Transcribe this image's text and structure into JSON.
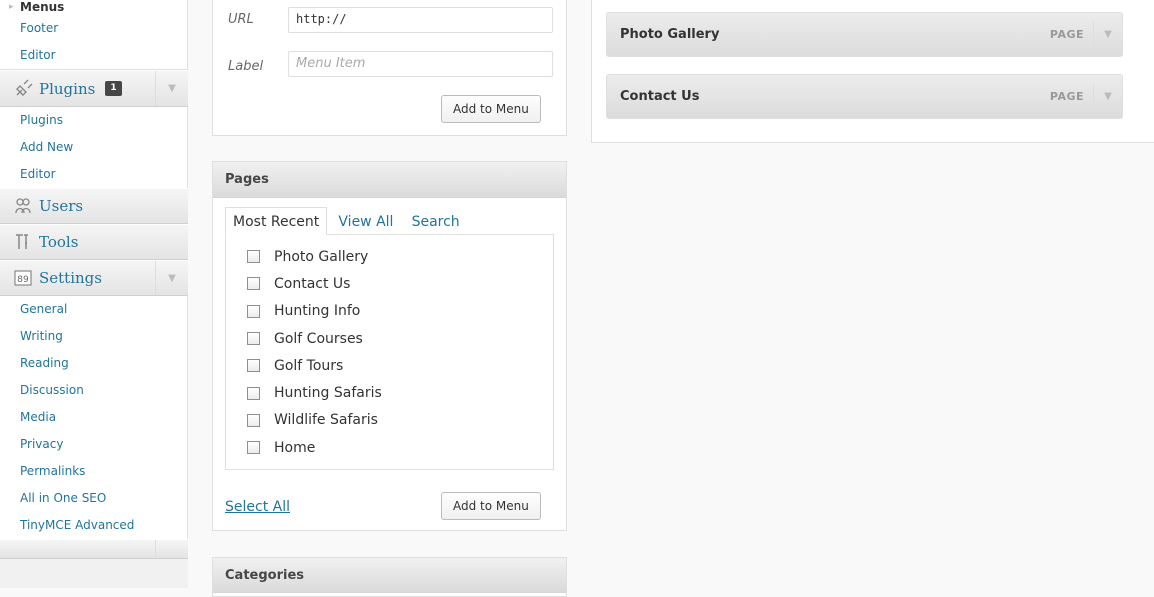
{
  "sidebar": {
    "appearance_sub": [
      {
        "label": "Menus",
        "current": true
      },
      {
        "label": "Footer"
      },
      {
        "label": "Editor"
      }
    ],
    "plugins": {
      "label": "Plugins",
      "badge": "1",
      "icon": "plug-icon",
      "sub": [
        {
          "label": "Plugins"
        },
        {
          "label": "Add New"
        },
        {
          "label": "Editor"
        }
      ]
    },
    "users": {
      "label": "Users",
      "icon": "users-icon"
    },
    "tools": {
      "label": "Tools",
      "icon": "tools-icon"
    },
    "settings": {
      "label": "Settings",
      "icon": "settings-icon",
      "sub": [
        {
          "label": "General"
        },
        {
          "label": "Writing"
        },
        {
          "label": "Reading"
        },
        {
          "label": "Discussion"
        },
        {
          "label": "Media"
        },
        {
          "label": "Privacy"
        },
        {
          "label": "Permalinks"
        },
        {
          "label": "All in One SEO"
        },
        {
          "label": "TinyMCE Advanced"
        }
      ]
    },
    "colors": {
      "link": "#21759b",
      "badge": "#464646"
    }
  },
  "custom_links": {
    "url_label": "URL",
    "url_value": "http://",
    "label_label": "Label",
    "label_placeholder": "Menu Item",
    "add_button": "Add to Menu"
  },
  "pages_box": {
    "title": "Pages",
    "tabs": [
      "Most Recent",
      "View All",
      "Search"
    ],
    "items": [
      "Photo Gallery",
      "Contact Us",
      "Hunting Info",
      "Golf Courses",
      "Golf Tours",
      "Hunting Safaris",
      "Wildlife Safaris",
      "Home"
    ],
    "select_all": "Select All",
    "add_button": "Add to Menu"
  },
  "categories_box": {
    "title": "Categories"
  },
  "menu_structure": {
    "items": [
      {
        "title": "Photo Gallery",
        "type": "PAGE"
      },
      {
        "title": "Contact Us",
        "type": "PAGE"
      }
    ]
  }
}
